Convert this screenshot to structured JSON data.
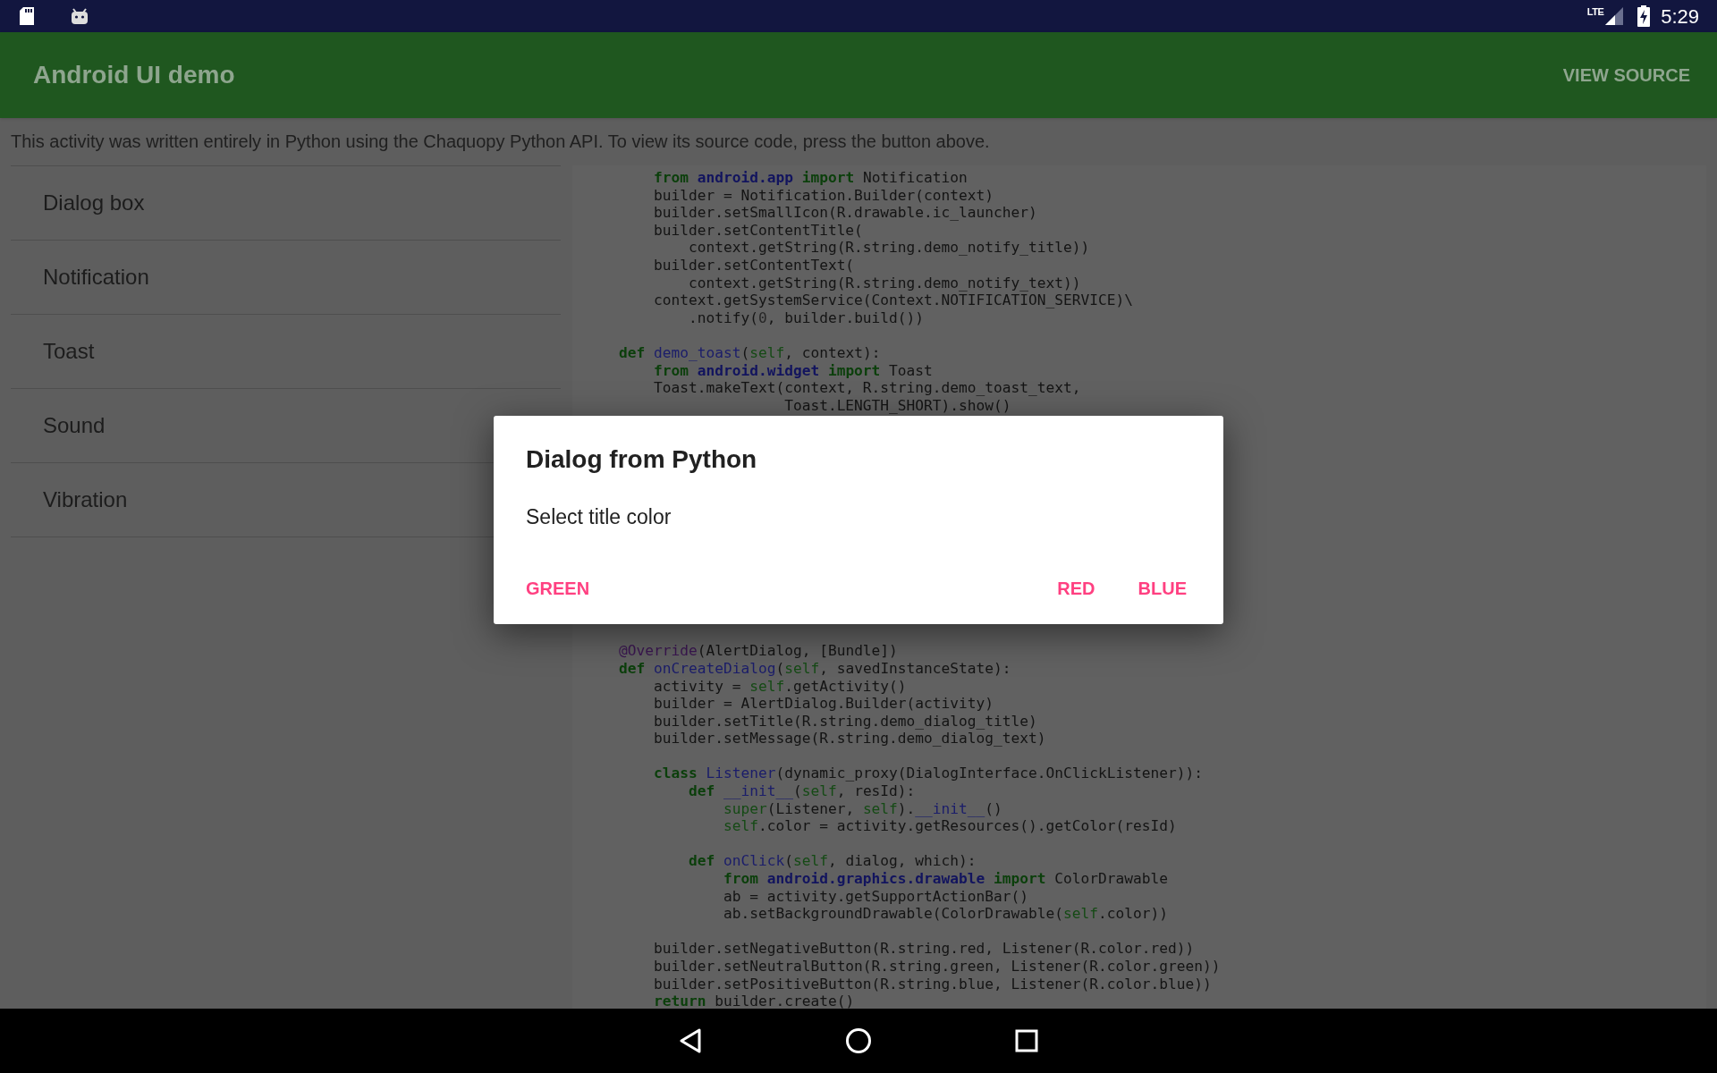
{
  "status_bar": {
    "network": "LTE",
    "time": "5:29"
  },
  "app_bar": {
    "title": "Android UI demo",
    "action": "VIEW SOURCE"
  },
  "description": "This activity was written entirely in Python using the Chaquopy Python API. To view its source code, press the button above.",
  "demos": [
    {
      "label": "Dialog box"
    },
    {
      "label": "Notification"
    },
    {
      "label": "Toast"
    },
    {
      "label": "Sound"
    },
    {
      "label": "Vibration"
    }
  ],
  "code_blocks": [
    {
      "lines": [
        {
          "tokens": [
            {
              "kind": "kw",
              "text": "        from"
            },
            {
              "kind": "mod",
              "text": " android.app"
            },
            {
              "kind": "kw",
              "text": " import"
            },
            " Notification"
          ]
        },
        {
          "tokens": [
            "        builder = Notification.Builder(context)"
          ]
        },
        {
          "tokens": [
            "        builder.setSmallIcon(R.drawable.ic_launcher)"
          ]
        },
        {
          "tokens": [
            "        builder.setContentTitle("
          ]
        },
        {
          "tokens": [
            "            context.getString(R.string.demo_notify_title))"
          ]
        },
        {
          "tokens": [
            "        builder.setContentText("
          ]
        },
        {
          "tokens": [
            "            context.getString(R.string.demo_notify_text))"
          ]
        },
        {
          "tokens": [
            "        context.getSystemService(Context.NOTIFICATION_SERVICE)\\"
          ]
        },
        {
          "tokens": [
            "            .notify(",
            {
              "kind": "num",
              "text": "0"
            },
            ", builder.build())"
          ]
        },
        {
          "kind": "blank"
        },
        {
          "tokens": [
            {
              "kind": "kw",
              "text": "    def"
            },
            {
              "kind": "fn",
              "text": " demo_toast"
            },
            "(",
            {
              "kind": "self",
              "text": "self"
            },
            ", context):"
          ]
        },
        {
          "tokens": [
            {
              "kind": "kw",
              "text": "        from"
            },
            {
              "kind": "mod",
              "text": " android.widget"
            },
            {
              "kind": "kw",
              "text": " import"
            },
            " Toast"
          ]
        },
        {
          "tokens": [
            "        Toast.makeText(context, R.string.demo_toast_text,"
          ]
        },
        {
          "tokens": [
            "                       Toast.LENGTH_SHORT).show()"
          ]
        }
      ]
    },
    {
      "lines": [
        {
          "tokens": [
            {
              "kind": "deco",
              "text": "    @Override"
            },
            "(AlertDialog, [Bundle])"
          ]
        },
        {
          "tokens": [
            {
              "kind": "kw",
              "text": "    def"
            },
            {
              "kind": "fn",
              "text": " onCreateDialog"
            },
            "(",
            {
              "kind": "self",
              "text": "self"
            },
            ", savedInstanceState):"
          ]
        },
        {
          "tokens": [
            "        activity = ",
            {
              "kind": "self",
              "text": "self"
            },
            ".getActivity()"
          ]
        },
        {
          "tokens": [
            "        builder = AlertDialog.Builder(activity)"
          ]
        },
        {
          "tokens": [
            "        builder.setTitle(R.string.demo_dialog_title)"
          ]
        },
        {
          "tokens": [
            "        builder.setMessage(R.string.demo_dialog_text)"
          ]
        },
        {
          "kind": "blank"
        },
        {
          "tokens": [
            {
              "kind": "kw",
              "text": "        class"
            },
            {
              "kind": "fn",
              "text": " Listener"
            },
            "(dynamic_proxy(DialogInterface.OnClickListener)):"
          ]
        },
        {
          "tokens": [
            {
              "kind": "kw",
              "text": "            def"
            },
            {
              "kind": "fn",
              "text": " __init__"
            },
            "(",
            {
              "kind": "self",
              "text": "self"
            },
            ", resId):"
          ]
        },
        {
          "tokens": [
            {
              "kind": "self",
              "text": "                super"
            },
            "(Listener, ",
            {
              "kind": "self",
              "text": "self"
            },
            ").",
            {
              "kind": "fn",
              "text": "__init__"
            },
            "()"
          ]
        },
        {
          "tokens": [
            {
              "kind": "self",
              "text": "                self"
            },
            ".color = activity.getResources().getColor(resId)"
          ]
        },
        {
          "kind": "blank"
        },
        {
          "tokens": [
            {
              "kind": "kw",
              "text": "            def"
            },
            {
              "kind": "fn",
              "text": " onClick"
            },
            "(",
            {
              "kind": "self",
              "text": "self"
            },
            ", dialog, which):"
          ]
        },
        {
          "tokens": [
            {
              "kind": "kw",
              "text": "                from"
            },
            {
              "kind": "mod",
              "text": " android.graphics.drawable"
            },
            {
              "kind": "kw",
              "text": " import"
            },
            " ColorDrawable"
          ]
        },
        {
          "tokens": [
            "                ab = activity.getSupportActionBar()"
          ]
        },
        {
          "tokens": [
            "                ab.setBackgroundDrawable(ColorDrawable(",
            {
              "kind": "self",
              "text": "self"
            },
            ".color))"
          ]
        },
        {
          "kind": "blank"
        },
        {
          "tokens": [
            "        builder.setNegativeButton(R.string.red, Listener(R.color.red))"
          ]
        },
        {
          "tokens": [
            "        builder.setNeutralButton(R.string.green, Listener(R.color.green))"
          ]
        },
        {
          "tokens": [
            "        builder.setPositiveButton(R.string.blue, Listener(R.color.blue))"
          ]
        },
        {
          "tokens": [
            {
              "kind": "kw",
              "text": "        return"
            },
            " builder.create()"
          ]
        }
      ]
    }
  ],
  "dialog": {
    "title": "Dialog from Python",
    "message": "Select title color",
    "buttons_left": [
      {
        "label": "GREEN"
      }
    ],
    "buttons_right": [
      {
        "label": "RED"
      },
      {
        "label": "BLUE"
      }
    ]
  }
}
